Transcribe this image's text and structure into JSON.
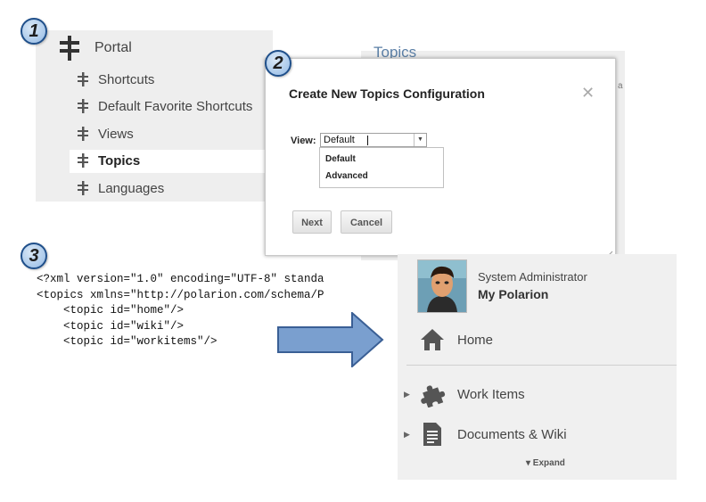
{
  "steps": [
    "1",
    "2",
    "3"
  ],
  "nav": {
    "root_label": "Portal",
    "items": [
      {
        "label": "Shortcuts",
        "selected": false
      },
      {
        "label": "Default Favorite Shortcuts",
        "selected": false
      },
      {
        "label": "Views",
        "selected": false
      },
      {
        "label": "Topics",
        "selected": true
      },
      {
        "label": "Languages",
        "selected": false
      }
    ]
  },
  "background": {
    "title": "Topics",
    "edge_char": "a"
  },
  "dialog": {
    "title": "Create New Topics Configuration",
    "close_glyph": "✕",
    "view_label": "View:",
    "view_value": "Default",
    "options": [
      "Default",
      "Advanced"
    ],
    "next_label": "Next",
    "cancel_label": "Cancel"
  },
  "xml": {
    "lines": [
      "<?xml version=\"1.0\" encoding=\"UTF-8\" standa",
      "<topics xmlns=\"http://polarion.com/schema/P",
      "    <topic id=\"home\"/>",
      "    <topic id=\"wiki\"/>",
      "    <topic id=\"workitems\"/>"
    ]
  },
  "sidebar": {
    "user_name": "System Administrator",
    "space_name": "My Polarion",
    "items": [
      {
        "label": "Home",
        "icon": "home-icon"
      },
      {
        "label": "Work Items",
        "icon": "puzzle-icon"
      },
      {
        "label": "Documents & Wiki",
        "icon": "document-icon"
      }
    ],
    "expand_label": "▾ Expand"
  },
  "colors": {
    "arrow_fill": "#7a9fcf",
    "arrow_stroke": "#3a5f95",
    "panel_bg": "#eeeeee"
  }
}
